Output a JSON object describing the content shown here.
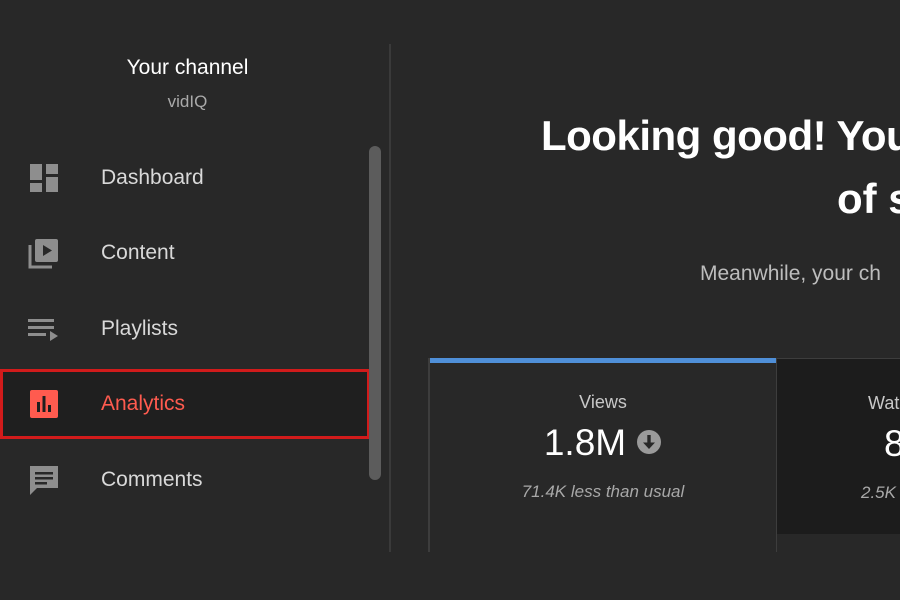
{
  "channel": {
    "title": "Your channel",
    "subtitle": "vidIQ"
  },
  "sidebar": {
    "items": [
      {
        "label": "Dashboard",
        "icon": "dashboard-icon",
        "active": false
      },
      {
        "label": "Content",
        "icon": "content-icon",
        "active": false
      },
      {
        "label": "Playlists",
        "icon": "playlists-icon",
        "active": false
      },
      {
        "label": "Analytics",
        "icon": "analytics-icon",
        "active": true
      },
      {
        "label": "Comments",
        "icon": "comments-icon",
        "active": false
      }
    ]
  },
  "main": {
    "headline_line1": "Looking good! You",
    "headline_line2": "of s",
    "subline": "Meanwhile, your ch"
  },
  "cards": {
    "views": {
      "title": "Views",
      "value": "1.8M",
      "trend_icon": "down-arrow-icon",
      "note": "71.4K less than usual"
    },
    "watch": {
      "title": "Wat",
      "value": "8",
      "note": "2.5K"
    }
  },
  "colors": {
    "background": "#282828",
    "accent_active": "#ff5b4f",
    "active_border": "#d11b1b",
    "card_topbar": "#4f8fd8"
  }
}
